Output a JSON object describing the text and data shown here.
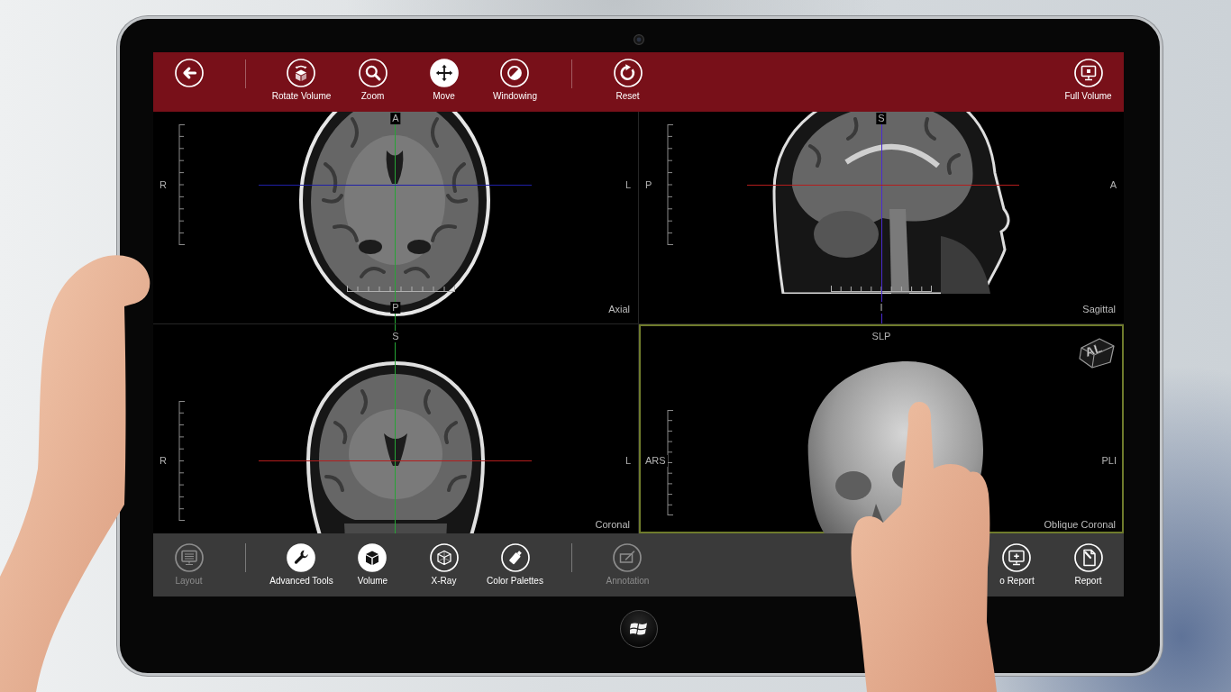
{
  "top_toolbar": {
    "sections": [
      {
        "items": [
          {
            "selected": false
          }
        ]
      },
      {
        "items": [
          {
            "label": "Rotate Volume",
            "selected": false
          },
          {
            "label": "Zoom",
            "selected": false
          },
          {
            "label": "Move",
            "selected": true
          },
          {
            "label": "Windowing",
            "selected": false
          }
        ]
      },
      {
        "items": [
          {
            "label": "Reset",
            "selected": false
          }
        ]
      }
    ],
    "end": [
      {
        "label": "Full Volume",
        "selected": false
      }
    ]
  },
  "viewports": [
    {
      "kind": "axial",
      "name": "Axial",
      "selected": false,
      "labels": {
        "top": "A",
        "left": "R",
        "right": "L",
        "bottom": "P"
      },
      "lines": [
        {
          "kind": "vertical",
          "color": "#27a336"
        },
        {
          "kind": "horizontal",
          "color": "#1f1fa6"
        }
      ]
    },
    {
      "kind": "sagittal",
      "name": "Sagittal",
      "selected": false,
      "labels": {
        "top": "S",
        "left": "P",
        "right": "A",
        "bottom": "I"
      },
      "lines": [
        {
          "kind": "vertical",
          "color": "#4a2bd1"
        },
        {
          "kind": "horizontal",
          "color": "#b31d1d"
        }
      ]
    },
    {
      "kind": "coronal",
      "name": "Coronal",
      "selected": false,
      "labels": {
        "top": "S",
        "left": "R",
        "right": "L"
      },
      "lines": [
        {
          "kind": "vertical",
          "color": "#27a336"
        },
        {
          "kind": "horizontal",
          "color": "#b31d1d"
        }
      ]
    },
    {
      "kind": "volume",
      "name": "Oblique Coronal",
      "selected": true,
      "labels": {
        "top": "SLP",
        "left": "ARS",
        "right": "PLI"
      },
      "orientation_cube": {
        "label": "AL"
      }
    }
  ],
  "bottom_toolbar": {
    "sections": [
      {
        "items": [
          {
            "label": "Layout",
            "selected": false,
            "disabled": true
          }
        ]
      },
      {
        "items": [
          {
            "label": "Advanced Tools",
            "selected": true,
            "disabled": false
          },
          {
            "label": "Volume",
            "selected": true,
            "disabled": false
          },
          {
            "label": "X-Ray",
            "selected": false,
            "disabled": false
          },
          {
            "label": "Color Palettes",
            "selected": false,
            "disabled": false
          }
        ]
      },
      {
        "items": [
          {
            "label": "Annotation",
            "selected": false,
            "disabled": true
          }
        ]
      }
    ],
    "end": [
      {
        "label": "o Report",
        "selected": false,
        "disabled": false
      },
      {
        "label": "Report",
        "selected": false,
        "disabled": false
      }
    ]
  }
}
